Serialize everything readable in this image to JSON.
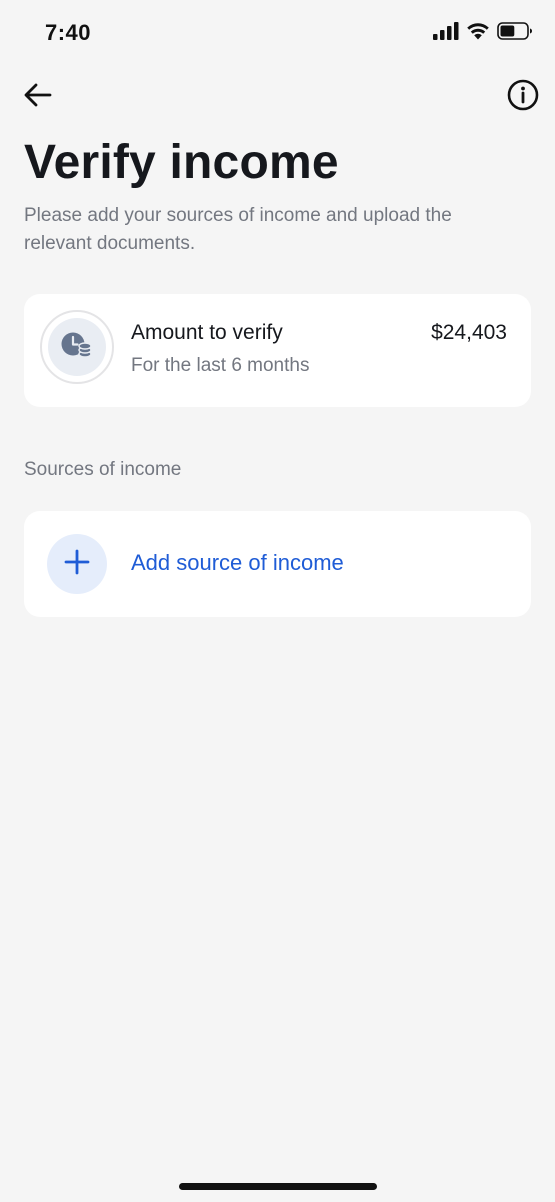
{
  "status_bar": {
    "time": "7:40",
    "icons": [
      "cellular-signal-icon",
      "wifi-icon",
      "battery-icon"
    ],
    "battery_level": 0.55
  },
  "nav": {
    "back_icon": "arrow-left-icon",
    "info_icon": "info-circle-icon"
  },
  "page": {
    "title": "Verify income",
    "subtitle": "Please add your sources of income and upload the relevant documents."
  },
  "amount_card": {
    "icon": "clock-coins-icon",
    "title": "Amount to verify",
    "subtitle": "For the last 6 months",
    "value": "$24,403"
  },
  "sources": {
    "section_label": "Sources of income",
    "add_icon": "plus-icon",
    "add_label": "Add source of income"
  },
  "colors": {
    "background": "#f5f5f5",
    "card": "#ffffff",
    "accent": "#1f5cd6",
    "accent_soft": "#e5edfb",
    "text_primary": "#16181d",
    "text_secondary": "#737780"
  }
}
